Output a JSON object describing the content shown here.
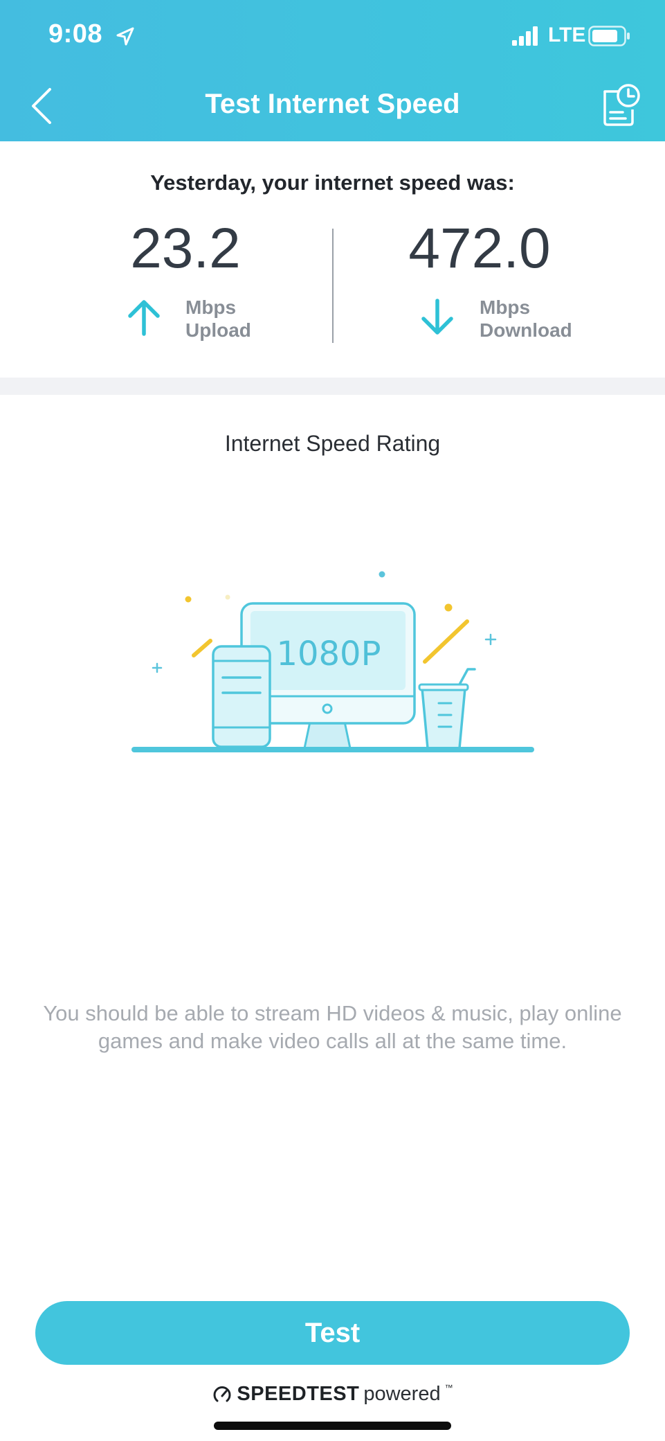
{
  "status_bar": {
    "time": "9:08",
    "network": "LTE"
  },
  "header": {
    "title": "Test Internet Speed"
  },
  "summary": {
    "heading": "Yesterday, your internet speed was:",
    "upload": {
      "value": "23.2",
      "unit": "Mbps",
      "label": "Upload"
    },
    "download": {
      "value": "472.0",
      "unit": "Mbps",
      "label": "Download"
    }
  },
  "rating": {
    "heading": "Internet Speed Rating",
    "resolution": "1080P",
    "description": "You should be able to stream HD videos & music, play online games and make video calls all at the same time."
  },
  "actions": {
    "test_label": "Test"
  },
  "footer": {
    "brand": "SPEEDTEST",
    "powered": "powered",
    "trademark": "™"
  },
  "colors": {
    "accent": "#42c5dd",
    "header_gradient_start": "#44bde0",
    "header_gradient_end": "#3ec7dc",
    "illustration_yellow": "#f2c52f",
    "separator": "#f1f2f5"
  },
  "icons": {
    "back": "chevron-left-icon",
    "history": "report-history-icon",
    "upload": "arrow-up-icon",
    "download": "arrow-down-icon",
    "brand": "speedometer-icon"
  }
}
